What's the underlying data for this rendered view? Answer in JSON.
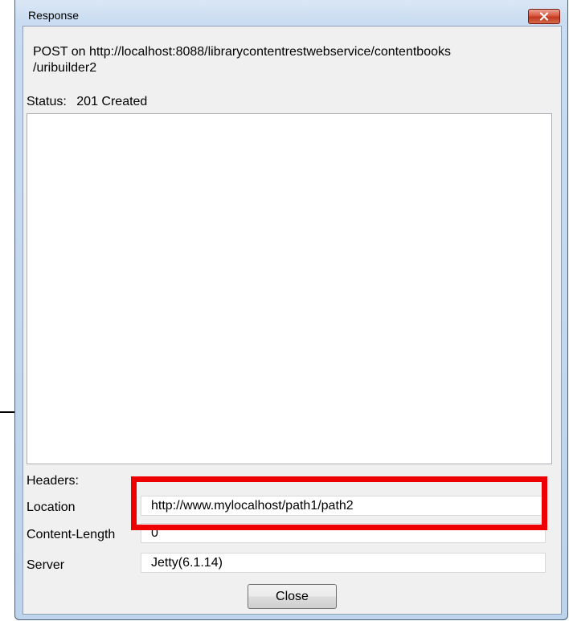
{
  "window": {
    "title": "Response",
    "close_icon": "close-x-icon"
  },
  "request": {
    "line1": "POST on http://localhost:8088/librarycontentrestwebservice/contentbooks",
    "line2": "/uribuilder2"
  },
  "status": {
    "label": "Status:",
    "value": "201 Created"
  },
  "response_body": "",
  "headers": {
    "label": "Headers:",
    "rows": [
      {
        "name": "Location",
        "value": "http://www.mylocalhost/path1/path2"
      },
      {
        "name": "Content-Length",
        "value": "0"
      },
      {
        "name": "Server",
        "value": "Jetty(6.1.14)"
      }
    ]
  },
  "buttons": {
    "close_label": "Close"
  },
  "colors": {
    "highlight": "#ee0000",
    "close_x": "#c0391f"
  }
}
